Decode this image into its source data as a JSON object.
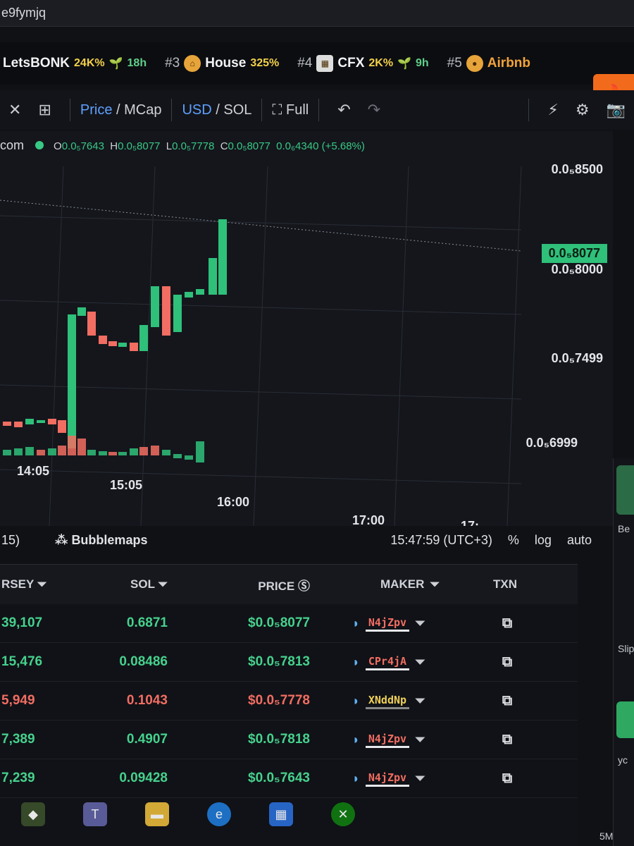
{
  "url_fragment": "e9fymjq",
  "trending": [
    {
      "rank": "",
      "name": "LetsBONK",
      "pct": "24K%",
      "age": "18h"
    },
    {
      "rank": "#3",
      "name": "House",
      "pct": "325%",
      "age": ""
    },
    {
      "rank": "#4",
      "name": "CFX",
      "pct": "2K%",
      "age": "9h"
    },
    {
      "rank": "#5",
      "name": "Airbnb",
      "pct": "",
      "age": ""
    }
  ],
  "toolbar": {
    "price": "Price",
    "mcap": "MCap",
    "usd": "USD",
    "sol": "SOL",
    "full": "Full"
  },
  "ohlc": {
    "symbol": "com",
    "o_label": "O",
    "o": "0.0₅7643",
    "h_label": "H",
    "h": "0.0₅8077",
    "l_label": "L",
    "l": "0.0₅7778",
    "c_label": "C",
    "c": "0.0₅8077",
    "change": "0.0₆4340 (+5.68%)"
  },
  "chart_data": {
    "type": "candlestick",
    "current_price_tag": "0.0₅8077",
    "y_ticks": [
      "0.0₅8500",
      "0.0₅8000",
      "0.0₅7499",
      "0.0₅6999"
    ],
    "x_ticks": [
      "14:05",
      "15:05",
      "16:00",
      "17:00",
      "17:"
    ],
    "up_color": "#2fc07a",
    "down_color": "#f26d62"
  },
  "time_row": {
    "left": "15)",
    "bubblemaps": "Bubblemaps",
    "clock": "15:47:59 (UTC+3)",
    "pct": "%",
    "log": "log",
    "auto": "auto"
  },
  "table": {
    "headers": {
      "c1": "RSEY",
      "sol": "SOL",
      "price": "PRICE",
      "maker": "MAKER",
      "txn": "TXN"
    },
    "rows": [
      {
        "c1": "39,107",
        "sol": "0.6871",
        "price": "$0.0₅8077",
        "maker": "N4jZpv",
        "side": "buy",
        "maker_style": "red"
      },
      {
        "c1": "15,476",
        "sol": "0.08486",
        "price": "$0.0₅7813",
        "maker": "CPr4jA",
        "side": "buy",
        "maker_style": "red"
      },
      {
        "c1": "5,949",
        "sol": "0.1043",
        "price": "$0.0₅7778",
        "maker": "XNddNp",
        "side": "sell",
        "maker_style": "yel"
      },
      {
        "c1": "7,389",
        "sol": "0.4907",
        "price": "$0.0₅7818",
        "maker": "N4jZpv",
        "side": "buy",
        "maker_style": "red"
      },
      {
        "c1": "7,239",
        "sol": "0.09428",
        "price": "$0.0₅7643",
        "maker": "N4jZpv",
        "side": "buy",
        "maker_style": "red"
      }
    ]
  },
  "side_panel": {
    "label1": "Be",
    "label2": "Slip",
    "label3": "yc",
    "label4": "5M"
  }
}
